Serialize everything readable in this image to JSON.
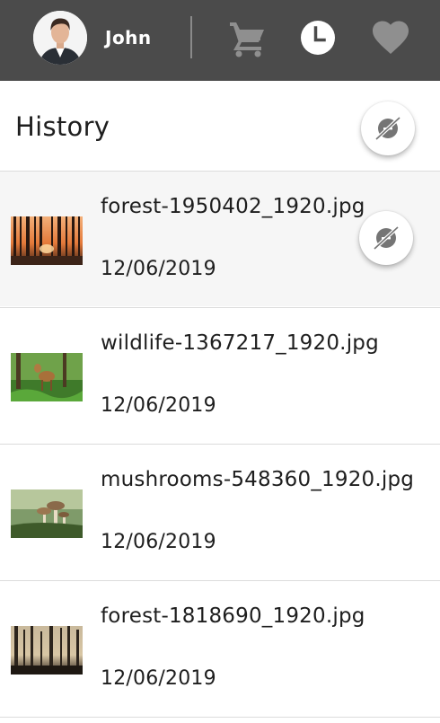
{
  "user": {
    "name": "John"
  },
  "nav": {
    "icons": [
      "cart-icon",
      "clock-icon",
      "heart-icon"
    ],
    "active": "clock-icon"
  },
  "header": {
    "title": "History",
    "action_icon": "hide-icon"
  },
  "history": {
    "items": [
      {
        "name": "forest-1950402_1920.jpg",
        "date": "12/06/2019",
        "thumb": "forest-sunset",
        "selected": true
      },
      {
        "name": "wildlife-1367217_1920.jpg",
        "date": "12/06/2019",
        "thumb": "deer-forest",
        "selected": false
      },
      {
        "name": "mushrooms-548360_1920.jpg",
        "date": "12/06/2019",
        "thumb": "mushrooms",
        "selected": false
      },
      {
        "name": "forest-1818690_1920.jpg",
        "date": "12/06/2019",
        "thumb": "misty-forest",
        "selected": false
      }
    ]
  },
  "colors": {
    "topbar": "#4b4b4b",
    "icon": "#8f8f8f",
    "active_icon_bg": "#ffffff",
    "selected_row": "#f6f6f6",
    "divider": "#dcdcdc",
    "text": "#1e1e1e"
  }
}
